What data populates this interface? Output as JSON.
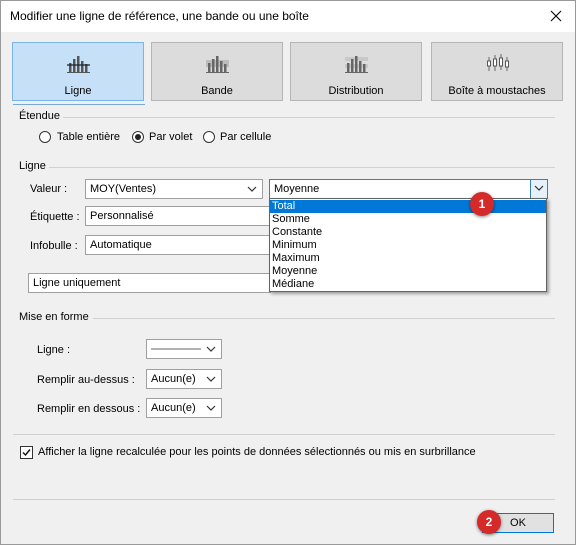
{
  "window": {
    "title": "Modifier une ligne de référence, une bande ou une boîte"
  },
  "tiles": [
    {
      "label": "Ligne",
      "icon": "reference-line-chart-icon",
      "active": true
    },
    {
      "label": "Bande",
      "icon": "band-chart-icon",
      "active": false
    },
    {
      "label": "Distribution",
      "icon": "distribution-chart-icon",
      "active": false
    },
    {
      "label": "Boîte à moustaches",
      "icon": "box-plot-icon",
      "active": false
    }
  ],
  "scope": {
    "title": "Étendue",
    "options": [
      {
        "label": "Table entière",
        "checked": false
      },
      {
        "label": "Par volet",
        "checked": true
      },
      {
        "label": "Par cellule",
        "checked": false
      }
    ]
  },
  "line": {
    "title": "Ligne",
    "value_label": "Valeur :",
    "value_field": "MOY(Ventes)",
    "aggregation": "Moyenne",
    "label_label": "Étiquette :",
    "label_value": "Personnalisé",
    "tooltip_label": "Infobulle :",
    "tooltip_value": "Automatique",
    "display_value": "Ligne uniquement",
    "aggregation_options": [
      "Total",
      "Somme",
      "Constante",
      "Minimum",
      "Maximum",
      "Moyenne",
      "Médiane"
    ],
    "highlighted_option": "Total"
  },
  "format": {
    "title": "Mise en forme",
    "line_label": "Ligne :",
    "fill_above_label": "Remplir au-dessus :",
    "fill_above_value": "Aucun(e)",
    "fill_below_label": "Remplir en dessous :",
    "fill_below_value": "Aucun(e)"
  },
  "recalc": {
    "label": "Afficher la ligne recalculée pour les points de données sélectionnés ou mis en surbrillance",
    "checked": true
  },
  "badges": [
    "1",
    "2"
  ],
  "ok_label": "OK",
  "colors": {
    "accent": "#0078d7",
    "active_tile": "#c6e0f7",
    "badge": "#d42a2a"
  }
}
